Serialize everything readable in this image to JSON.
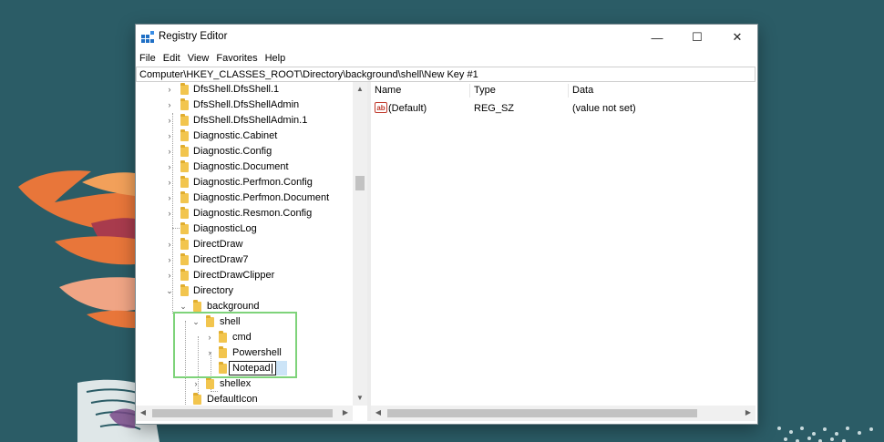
{
  "window": {
    "title": "Registry Editor"
  },
  "controls": {
    "minimize": "—",
    "maximize": "☐",
    "close": "✕"
  },
  "menu": [
    "File",
    "Edit",
    "View",
    "Favorites",
    "Help"
  ],
  "address": "Computer\\HKEY_CLASSES_ROOT\\Directory\\background\\shell\\New Key #1",
  "tree": [
    {
      "label": "DfsShell.DfsShell.1",
      "twisty": "›"
    },
    {
      "label": "DfsShell.DfsShellAdmin",
      "twisty": "›"
    },
    {
      "label": "DfsShell.DfsShellAdmin.1",
      "twisty": "›"
    },
    {
      "label": "Diagnostic.Cabinet",
      "twisty": "›"
    },
    {
      "label": "Diagnostic.Config",
      "twisty": "›"
    },
    {
      "label": "Diagnostic.Document",
      "twisty": "›"
    },
    {
      "label": "Diagnostic.Perfmon.Config",
      "twisty": "›"
    },
    {
      "label": "Diagnostic.Perfmon.Document",
      "twisty": "›"
    },
    {
      "label": "Diagnostic.Resmon.Config",
      "twisty": "›"
    },
    {
      "label": "DiagnosticLog",
      "twisty": ""
    },
    {
      "label": "DirectDraw",
      "twisty": "›"
    },
    {
      "label": "DirectDraw7",
      "twisty": "›"
    },
    {
      "label": "DirectDrawClipper",
      "twisty": "›"
    },
    {
      "label": "Directory",
      "twisty": "⌄"
    },
    {
      "label": "background",
      "twisty": "⌄"
    },
    {
      "label": "shell",
      "twisty": "⌄"
    },
    {
      "label": "cmd",
      "twisty": "›"
    },
    {
      "label": "Powershell",
      "twisty": "›"
    },
    {
      "label": "Notepad",
      "twisty": ""
    },
    {
      "label": "shellex",
      "twisty": "›"
    },
    {
      "label": "DefaultIcon",
      "twisty": ""
    }
  ],
  "list": {
    "columns": [
      "Name",
      "Type",
      "Data"
    ],
    "rows": [
      {
        "icon": "ab",
        "name": "(Default)",
        "type": "REG_SZ",
        "data": "(value not set)"
      }
    ]
  },
  "scroll": {
    "up": "▲",
    "down": "▼",
    "left": "◀",
    "right": "▶"
  },
  "colors": {
    "desktop": "#2b5c66",
    "highlight": "#7ed37a",
    "folder": "#f2c54e",
    "selection": "#cce4f7"
  }
}
